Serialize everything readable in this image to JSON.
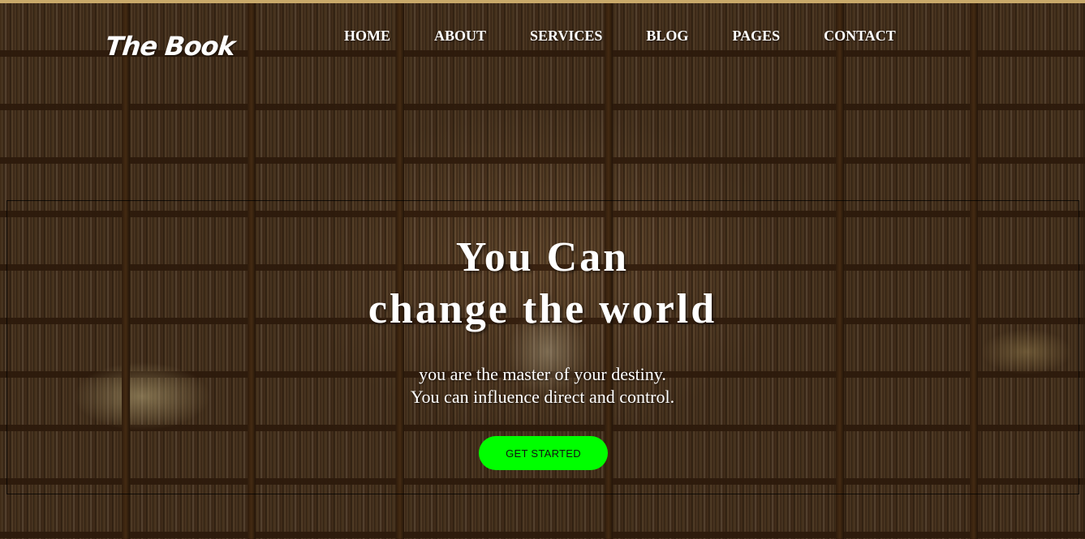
{
  "header": {
    "logo_text": "The Book",
    "nav": [
      {
        "label": "HOME"
      },
      {
        "label": "ABOUT"
      },
      {
        "label": "SERVICES"
      },
      {
        "label": "BLOG"
      },
      {
        "label": "PAGES"
      },
      {
        "label": "CONTACT"
      }
    ]
  },
  "hero": {
    "headline_line1": "You Can",
    "headline_line2": "change the world",
    "subtext_line1": "you are the master of your destiny.",
    "subtext_line2": "You can influence direct and control.",
    "cta_label": "GET STARTED"
  },
  "colors": {
    "cta_background": "#00ff00",
    "text": "#ffffff",
    "top_border": "#c9a96a"
  }
}
